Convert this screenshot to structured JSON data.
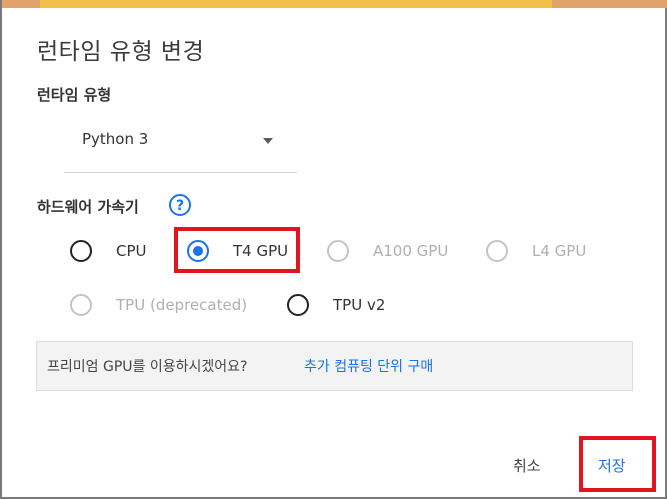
{
  "dialog": {
    "title": "런타임 유형 변경",
    "runtime_label": "런타임 유형",
    "runtime_value": "Python 3",
    "accelerator_label": "하드웨어 가속기",
    "help_icon": "question-circle-icon",
    "accent_color": "#1a73e8",
    "highlight_color": "#e1141f",
    "options": [
      {
        "label": "CPU",
        "state": "unselected"
      },
      {
        "label": "T4 GPU",
        "state": "selected"
      },
      {
        "label": "A100 GPU",
        "state": "disabled"
      },
      {
        "label": "L4 GPU",
        "state": "disabled"
      },
      {
        "label": "TPU (deprecated)",
        "state": "disabled"
      },
      {
        "label": "TPU v2",
        "state": "unselected"
      }
    ],
    "promo": {
      "question": "프리미엄 GPU를 이용하시겠어요?",
      "link": "추가 컴퓨팅 단위 구매"
    },
    "buttons": {
      "cancel": "취소",
      "save": "저장"
    }
  }
}
